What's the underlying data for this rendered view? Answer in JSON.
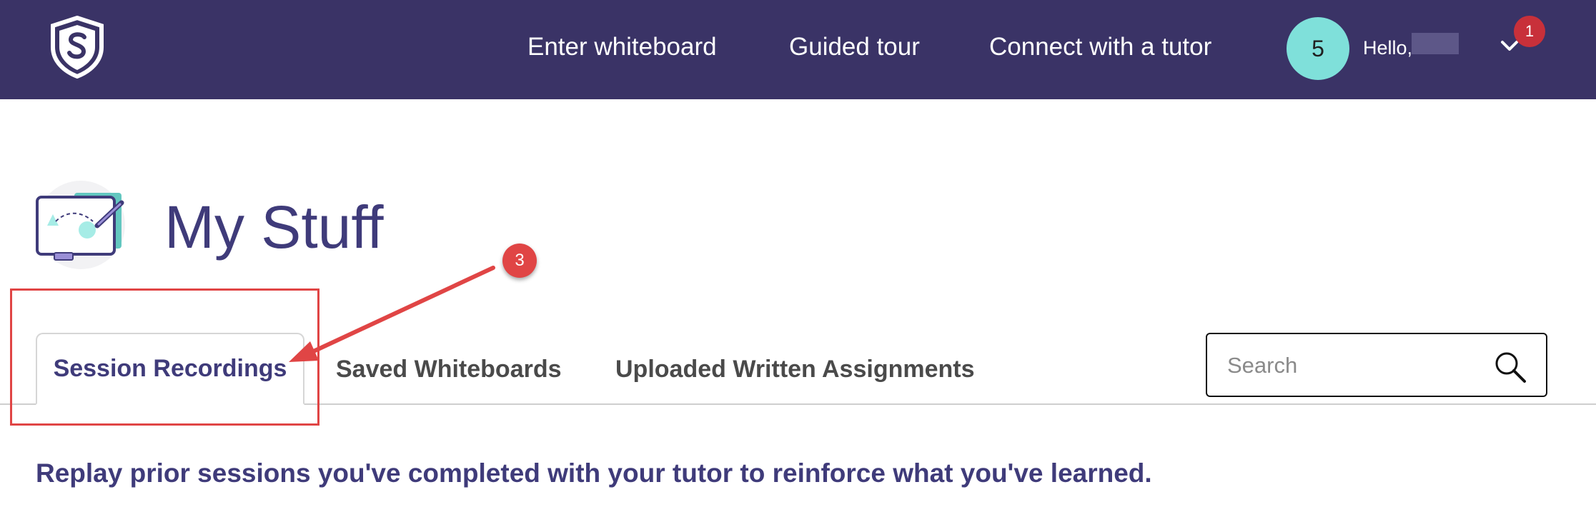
{
  "header": {
    "nav": [
      {
        "label": "Enter whiteboard"
      },
      {
        "label": "Guided tour"
      },
      {
        "label": "Connect with a tutor"
      }
    ],
    "avatar_text": "5",
    "greeting": "Hello,",
    "notification_count": "1",
    "colors": {
      "background": "#3a3366",
      "avatar": "#7fe0da",
      "badge": "#c8303a"
    }
  },
  "page": {
    "title": "My Stuff",
    "tabs": [
      {
        "label": "Session Recordings",
        "active": true
      },
      {
        "label": "Saved Whiteboards",
        "active": false
      },
      {
        "label": "Uploaded Written Assignments",
        "active": false
      }
    ],
    "search": {
      "placeholder": "Search",
      "value": ""
    },
    "subtitle": "Replay prior sessions you've completed with your tutor to reinforce what you've learned."
  },
  "annotation": {
    "step": "3",
    "color": "#e04545"
  },
  "icons": [
    "shield-s-logo-icon",
    "whiteboard-icon",
    "chevron-down-icon",
    "search-icon"
  ]
}
